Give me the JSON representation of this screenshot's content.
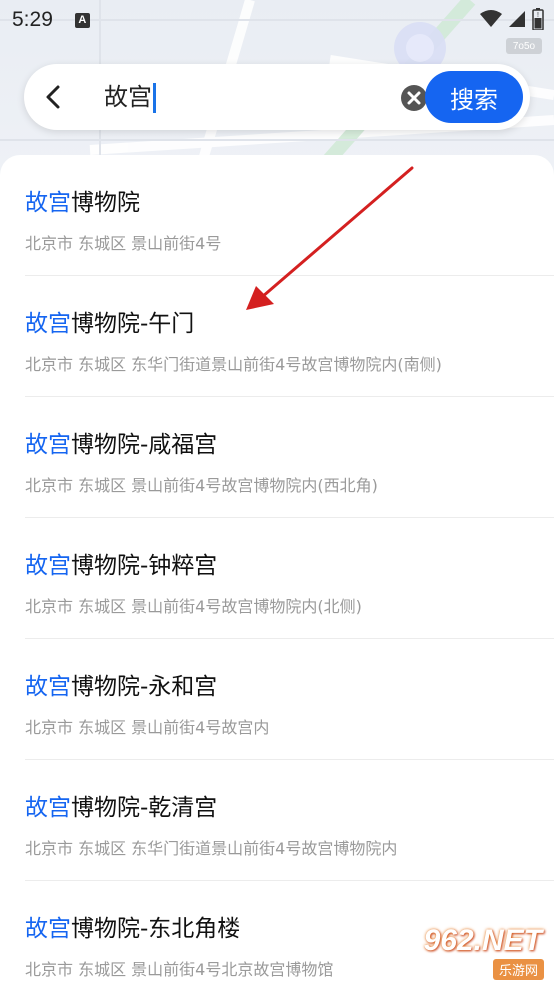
{
  "status_bar": {
    "time": "5:29",
    "notification_icon": "A"
  },
  "map_watermark": "7o5o",
  "search": {
    "query": "故宫",
    "button_label": "搜索"
  },
  "results": [
    {
      "highlight": "故宫",
      "rest": "博物院",
      "address": "北京市 东城区 景山前街4号"
    },
    {
      "highlight": "故宫",
      "rest": "博物院-午门",
      "address": "北京市 东城区 东华门街道景山前街4号故宫博物院内(南侧)"
    },
    {
      "highlight": "故宫",
      "rest": "博物院-咸福宫",
      "address": "北京市 东城区 景山前街4号故宫博物院内(西北角)"
    },
    {
      "highlight": "故宫",
      "rest": "博物院-钟粹宫",
      "address": "北京市 东城区 景山前街4号故宫博物院内(北侧)"
    },
    {
      "highlight": "故宫",
      "rest": "博物院-永和宫",
      "address": "北京市 东城区 景山前街4号故宫内"
    },
    {
      "highlight": "故宫",
      "rest": "博物院-乾清宫",
      "address": "北京市 东城区 东华门街道景山前街4号故宫博物院内"
    },
    {
      "highlight": "故宫",
      "rest": "博物院-东北角楼",
      "address": "北京市 东城区 景山前街4号北京故宫博物馆"
    }
  ],
  "watermark": {
    "brand": "962.NET",
    "sub": "乐游网"
  },
  "colors": {
    "accent": "#1565f1",
    "annotation": "#d42020"
  },
  "icons": [
    "back-arrow-icon",
    "clear-icon",
    "wifi-icon",
    "signal-icon",
    "battery-icon"
  ]
}
